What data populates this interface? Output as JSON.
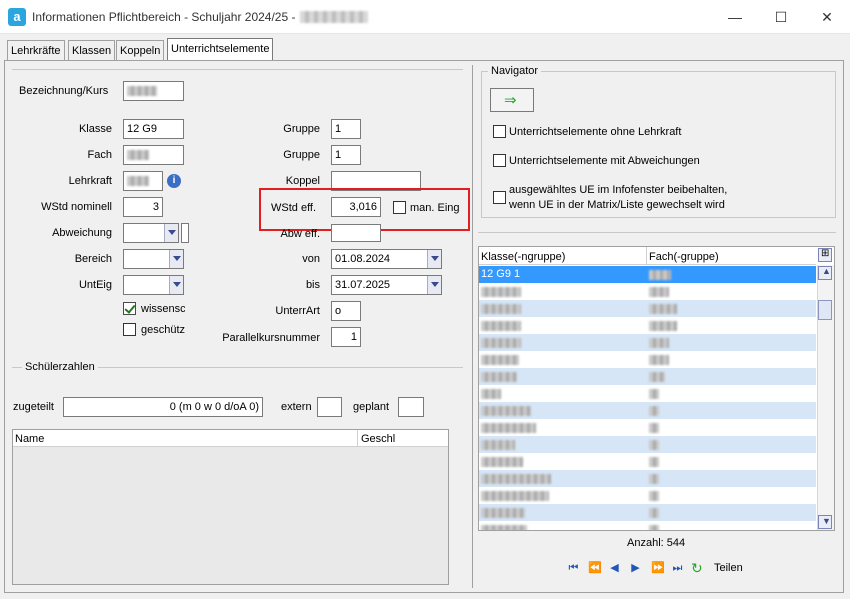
{
  "window": {
    "title": "Informationen Pflichtbereich - Schuljahr 2024/25 -",
    "minimize_icon": "minimize-icon",
    "maximize_icon": "maximize-icon",
    "close_icon": "close-icon"
  },
  "tabs": [
    {
      "label": "Lehrkräfte"
    },
    {
      "label": "Klassen"
    },
    {
      "label": "Koppeln"
    },
    {
      "label": "Unterrichtselemente"
    }
  ],
  "form": {
    "bezeichnung_label": "Bezeichnung/Kurs",
    "klasse_label": "Klasse",
    "klasse_value": "12 G9",
    "fach_label": "Fach",
    "lehrkraft_label": "Lehrkraft",
    "wstd_nominell_label": "WStd nominell",
    "wstd_nominell_value": "3",
    "abweichung_label": "Abweichung",
    "bereich_label": "Bereich",
    "unteig_label": "UntEig",
    "wissensc_label": "wissensc",
    "geschuetz_label": "geschütz",
    "gruppe1_label": "Gruppe",
    "gruppe1_value": "1",
    "gruppe2_label": "Gruppe",
    "gruppe2_value": "1",
    "koppel_label": "Koppel",
    "wstd_eff_label": "WStd eff.",
    "wstd_eff_value": "3,016",
    "man_eing_label": "man. Eing",
    "abw_eff_label": "Abw eff.",
    "von_label": "von",
    "von_value": "01.08.2024",
    "bis_label": "bis",
    "bis_value": "31.07.2025",
    "unterrart_label": "UnterrArt",
    "unterrart_value": "o",
    "parallelkurs_label": "Parallelkursnummer",
    "parallelkurs_value": "1"
  },
  "schueler": {
    "title": "Schülerzahlen",
    "zugeteilt_label": "zugeteilt",
    "zugeteilt_value": "0 (m 0 w 0 d/oA 0)",
    "extern_label": "extern",
    "geplant_label": "geplant",
    "col_name": "Name",
    "col_geschl": "Geschl"
  },
  "navigator": {
    "title": "Navigator",
    "opt1": "Unterrichtselemente ohne Lehrkraft",
    "opt2": "Unterrichtselemente mit Abweichungen",
    "opt3_line1": "ausgewähltes UE im Infofenster beibehalten,",
    "opt3_line2": "wenn UE in der Matrix/Liste gewechselt wird"
  },
  "list": {
    "col_klasse": "Klasse(-ngruppe)",
    "col_fach": "Fach(-gruppe)",
    "selected_row_klasse": "12 G9 1",
    "anzahl": "Anzahl: 544",
    "teilen_label": "Teilen"
  },
  "colors": {
    "accent": "#3399ff",
    "row_alt": "#d6e6f7",
    "highlight_border": "#e02020",
    "arrow_green": "#22aa22"
  }
}
